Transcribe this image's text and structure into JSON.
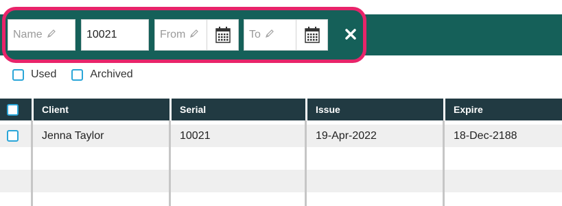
{
  "filters": {
    "name": {
      "placeholder": "Name",
      "value": ""
    },
    "serial": {
      "placeholder": "",
      "value": "10021"
    },
    "from": {
      "placeholder": "From",
      "value": ""
    },
    "to": {
      "placeholder": "To",
      "value": ""
    },
    "icons": {
      "edit": "pencil-icon",
      "calendar": "calendar-icon",
      "clear": "close-icon"
    }
  },
  "checkboxes": [
    {
      "label": "Used",
      "checked": false
    },
    {
      "label": "Archived",
      "checked": false
    }
  ],
  "table": {
    "columns": [
      "Client",
      "Serial",
      "Issue",
      "Expire"
    ],
    "rows": [
      {
        "client": "Jenna Taylor",
        "serial": "10021",
        "issue": "19-Apr-2022",
        "expire": "18-Dec-2188"
      }
    ]
  },
  "colors": {
    "header_bar": "#156059",
    "highlight": "#e8246a",
    "table_header": "#213a42",
    "checkbox": "#2aa6d8"
  }
}
